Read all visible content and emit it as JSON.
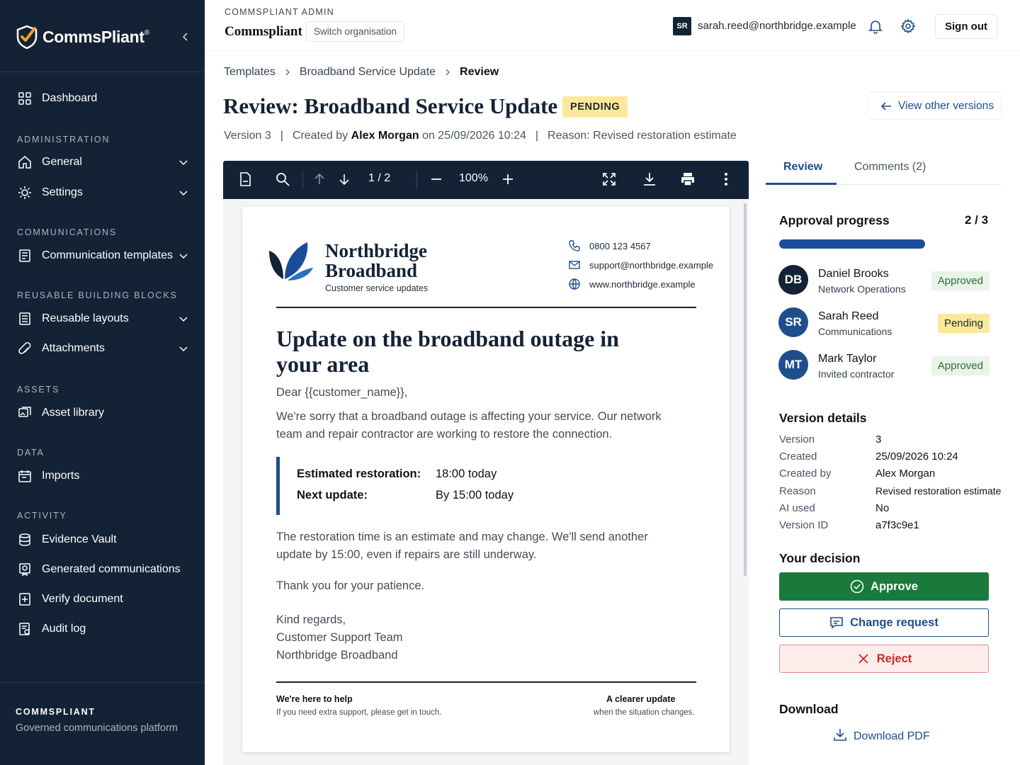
{
  "sidebar": {
    "brand": "CommsPliant",
    "brand_mark": "®",
    "items": [
      {
        "label": "Dashboard",
        "icon": "grid-icon"
      },
      {
        "section": "ADMINISTRATION"
      },
      {
        "label": "General",
        "icon": "home-icon",
        "expandable": true
      },
      {
        "label": "Settings",
        "icon": "sun-icon",
        "expandable": true
      },
      {
        "section": "COMMUNICATIONS"
      },
      {
        "label": "Communication templates",
        "icon": "document-icon",
        "expandable": true
      },
      {
        "section": "REUSABLE BUILDING BLOCKS"
      },
      {
        "label": "Reusable layouts",
        "icon": "layout-icon",
        "expandable": true
      },
      {
        "label": "Attachments",
        "icon": "paperclip-icon",
        "expandable": true
      },
      {
        "section": "ASSETS"
      },
      {
        "label": "Asset library",
        "icon": "image-icon"
      },
      {
        "section": "DATA"
      },
      {
        "label": "Imports",
        "icon": "calendar-icon"
      },
      {
        "section": "ACTIVITY"
      },
      {
        "label": "Evidence Vault",
        "icon": "database-icon"
      },
      {
        "label": "Generated communications",
        "icon": "certificate-icon"
      },
      {
        "label": "Verify document",
        "icon": "plus-square-icon"
      },
      {
        "label": "Audit log",
        "icon": "audit-icon"
      }
    ],
    "footer_title": "COMMSPLIANT",
    "footer_subtitle": "Governed communications platform"
  },
  "topbar": {
    "eyebrow": "COMMSPLIANT ADMIN",
    "app_name": "Commspliant",
    "switch_org": "Switch organisation",
    "user_initials": "SR",
    "user_email": "sarah.reed@northbridge.example",
    "sign_out": "Sign out"
  },
  "breadcrumb": [
    "Templates",
    "Broadband Service Update",
    "Review"
  ],
  "page": {
    "title": "Review: Broadband Service Update",
    "status": "PENDING",
    "view_versions": "View other versions",
    "meta": {
      "version": "Version 3",
      "created_prefix": "Created by",
      "created_by": "Alex Morgan",
      "created_on": "on 25/09/2026 10:24",
      "reason": "Reason: Revised restoration estimate"
    }
  },
  "viewer": {
    "page_current": "1",
    "page_total": "2",
    "page_sep": "/",
    "zoom": "100%"
  },
  "document": {
    "brand_line1": "Northbridge",
    "brand_line2": "Broadband",
    "brand_sub": "Customer service updates",
    "phone": "0800 123 4567",
    "email": "support@northbridge.example",
    "website": "www.northbridge.example",
    "heading": "Update on the broadband outage in your area",
    "greeting": "Dear {{customer_name}},",
    "intro": "We're sorry that a broadband outage is affecting your service. Our network team and repair contractor are working to restore the connection.",
    "kv": [
      {
        "key": "Estimated restoration:",
        "value": "18:00 today"
      },
      {
        "key": "Next update:",
        "value": "By 15:00 today"
      }
    ],
    "note": "The restoration time is an estimate and may change. We'll send another update by 15:00, even if repairs are still underway.",
    "thanks": "Thank you for your patience.",
    "signoff": [
      "Kind regards,",
      "Customer Support Team",
      "Northbridge Broadband"
    ],
    "footer_left_title": "We're here to help",
    "footer_left_sub": "If you need extra support, please get in touch.",
    "footer_right_title": "A clearer update",
    "footer_right_sub": "when the situation changes."
  },
  "panel": {
    "tabs": [
      "Review",
      "Comments (2)"
    ],
    "approval_title": "Approval progress",
    "approval_count": "2 / 3",
    "approval_progress": 0.667,
    "approvers": [
      {
        "initials": "DB",
        "name": "Daniel Brooks",
        "role": "Network Operations",
        "status": "Approved",
        "color": "#142236"
      },
      {
        "initials": "SR",
        "name": "Sarah Reed",
        "role": "Communications",
        "status": "Pending",
        "color": "#1f4e8c"
      },
      {
        "initials": "MT",
        "name": "Mark Taylor",
        "role": "Invited contractor",
        "status": "Approved",
        "color": "#1f4e8c"
      }
    ],
    "version_title": "Version details",
    "version_details": [
      {
        "key": "Version",
        "value": "3"
      },
      {
        "key": "Created",
        "value": "25/09/2026 10:24"
      },
      {
        "key": "Created by",
        "value": "Alex Morgan"
      },
      {
        "key": "Reason",
        "value": "Revised restoration estimate"
      },
      {
        "key": "AI used",
        "value": "No"
      },
      {
        "key": "Version ID",
        "value": "a7f3c9e1"
      }
    ],
    "decision_title": "Your decision",
    "approve": "Approve",
    "change_request": "Change request",
    "reject": "Reject",
    "download_title": "Download",
    "download_pdf": "Download PDF"
  },
  "colors": {
    "sidebar_bg": "#142236",
    "accent": "#1f4e8c",
    "approve": "#1a7a3b",
    "reject": "#c62828",
    "pending_badge": "#fbe89a"
  }
}
